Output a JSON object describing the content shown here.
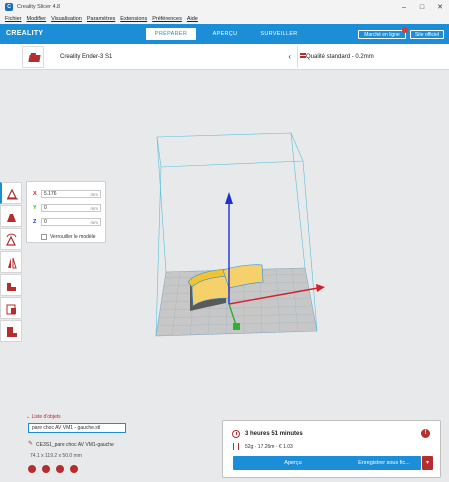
{
  "window": {
    "title": "Creality Slicer 4.8",
    "app_icon": "C"
  },
  "menu": [
    "Fichier",
    "Modifier",
    "Visualisation",
    "Paramètres",
    "Extensions",
    "Préférences",
    "Aide"
  ],
  "header": {
    "logo": "CREALITY",
    "tabs": [
      {
        "label": "PRÉPARER",
        "active": true
      },
      {
        "label": "APERÇU",
        "active": false
      },
      {
        "label": "SURVEILLER",
        "active": false
      }
    ],
    "marketplace_label": "Marché en ligne",
    "signin_label": "Site officiel",
    "accent": "#1c8ed8",
    "notification_color": "#e03b2a"
  },
  "printerbar": {
    "printer": "Creality Ender-3 S1",
    "quality": "Qualité standard - 0.2mm"
  },
  "move_panel": {
    "x": {
      "label": "X",
      "value": "5.176",
      "unit": "mm"
    },
    "y": {
      "label": "Y",
      "value": "0",
      "unit": "mm"
    },
    "z": {
      "label": "Z",
      "value": "0",
      "unit": "mm"
    },
    "drop_label": "Verrouiller le modèle"
  },
  "object_list": {
    "header": "Liste d'objets",
    "item": "pare choc AV VM1 - gauche.stl",
    "name": "CE3S1_pare choc AV VM1-gauche",
    "dims": "74.1 x 119.2 x 50.0 mm"
  },
  "job": {
    "time": "3 heures 51 minutes",
    "material": "52g · 17.26m · € 1.03",
    "preview_label": "Aperçu",
    "save_label": "Enregistrer sous fic..."
  }
}
